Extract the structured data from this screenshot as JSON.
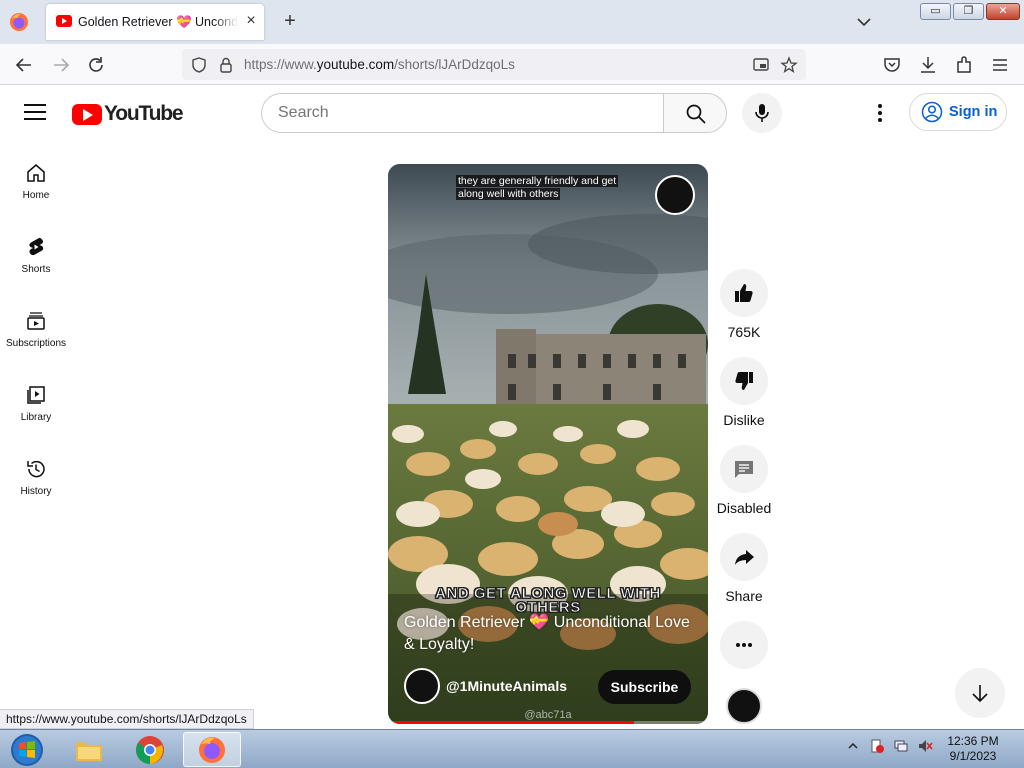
{
  "browser": {
    "tab": {
      "title": "Golden Retriever 💝 Unconditional Love & Loyalty! - YouTube",
      "close": "×"
    },
    "new_tab": "+",
    "window_buttons": {
      "minimize": "▭",
      "restore": "❐",
      "close": "✕"
    },
    "url": {
      "prefix": "https://www.",
      "domain": "youtube.com",
      "path": "/shorts/lJArDdzqoLs"
    },
    "status_bar_url": "https://www.youtube.com/shorts/lJArDdzqoLs",
    "icons": [
      "firefox-icon",
      "back-icon",
      "forward-icon",
      "reload-icon",
      "shield-icon",
      "lock-icon",
      "picture-in-picture-icon",
      "bookmark-star-icon",
      "pocket-icon",
      "downloads-icon",
      "extensions-icon",
      "menu-icon"
    ]
  },
  "youtube": {
    "logo_text": "YouTube",
    "search": {
      "placeholder": "Search"
    },
    "sign_in": "Sign in",
    "guide": [
      {
        "label": "Home",
        "icon": "home-icon"
      },
      {
        "label": "Shorts",
        "icon": "shorts-icon"
      },
      {
        "label": "Subscriptions",
        "icon": "subscriptions-icon"
      },
      {
        "label": "Library",
        "icon": "library-icon"
      },
      {
        "label": "History",
        "icon": "history-icon"
      }
    ],
    "short": {
      "caption_lines": [
        "they are generally friendly and get",
        "along well with others"
      ],
      "burned_text_lines": [
        "AND GET ALONG WELL WITH",
        "OTHERS"
      ],
      "title": "Golden Retriever 💝 Unconditional Love & Loyalty!",
      "channel": "@1MinuteAnimals",
      "subscribe": "Subscribe",
      "watermark": "@abc71a",
      "progress": 0.77
    },
    "actions": {
      "like": "765K",
      "dislike": "Dislike",
      "comments": "Disabled",
      "share": "Share"
    }
  },
  "taskbar": {
    "apps": [
      "start-orb",
      "file-explorer",
      "chrome",
      "firefox"
    ],
    "clock": {
      "time": "12:36 PM",
      "date": "9/1/2023"
    }
  },
  "colors": {
    "youtube_red": "#ff0000",
    "link_blue": "#065fd4",
    "firefox_orange": "#ff7139"
  }
}
